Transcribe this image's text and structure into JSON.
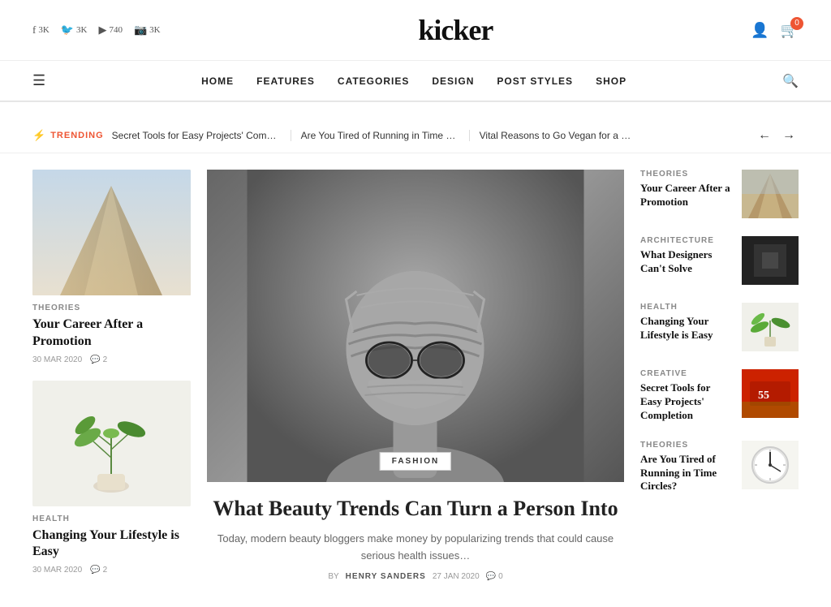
{
  "header": {
    "logo": "kicker",
    "social": [
      {
        "platform": "facebook",
        "icon": "f",
        "count": "3K"
      },
      {
        "platform": "twitter",
        "icon": "🐦",
        "count": "3K"
      },
      {
        "platform": "youtube",
        "icon": "▶",
        "count": "740"
      },
      {
        "platform": "instagram",
        "icon": "📷",
        "count": "3K"
      }
    ],
    "cart_count": "0"
  },
  "nav": {
    "hamburger_label": "☰",
    "links": [
      "HOME",
      "FEATURES",
      "CATEGORIES",
      "DESIGN",
      "POST STYLES",
      "SHOP"
    ],
    "search_icon": "🔍"
  },
  "trending": {
    "label": "TRENDING",
    "items": [
      "Secret Tools for Easy Projects' Compl …",
      "Are You Tired of Running in Time Circl…",
      "Vital Reasons to Go Vegan for a Month"
    ],
    "prev": "←",
    "next": "→"
  },
  "left_articles": [
    {
      "category": "THEORIES",
      "title": "Your Career After a Promotion",
      "date": "30 MAR 2020",
      "comments": "2",
      "img_type": "architecture"
    },
    {
      "category": "HEALTH",
      "title": "Changing Your Lifestyle is Easy",
      "date": "30 MAR 2020",
      "comments": "2",
      "img_type": "plant"
    }
  ],
  "hero": {
    "category": "FASHION",
    "title": "What Beauty Trends Can Turn a Person Into",
    "excerpt": "Today, modern beauty bloggers make money by popularizing trends that could cause serious health issues…",
    "author": "HENRY SANDERS",
    "date": "27 JAN 2020",
    "comments": "0",
    "by_label": "BY"
  },
  "right_articles": [
    {
      "category": "THEORIES",
      "title": "Your Career After a Promotion",
      "img_type": "arch-thumb"
    },
    {
      "category": "ARCHITECTURE",
      "title": "What Designers Can't Solve",
      "img_type": "dark-thumb"
    },
    {
      "category": "HEALTH",
      "title": "Changing Your Lifestyle is Easy",
      "img_type": "plant-thumb"
    },
    {
      "category": "CREATIVE",
      "title": "Secret Tools for Easy Projects' Completion",
      "img_type": "red-thumb"
    },
    {
      "category": "THEORIES",
      "title": "Are You Tired of Running in Time Circles?",
      "img_type": "clock-thumb"
    }
  ]
}
